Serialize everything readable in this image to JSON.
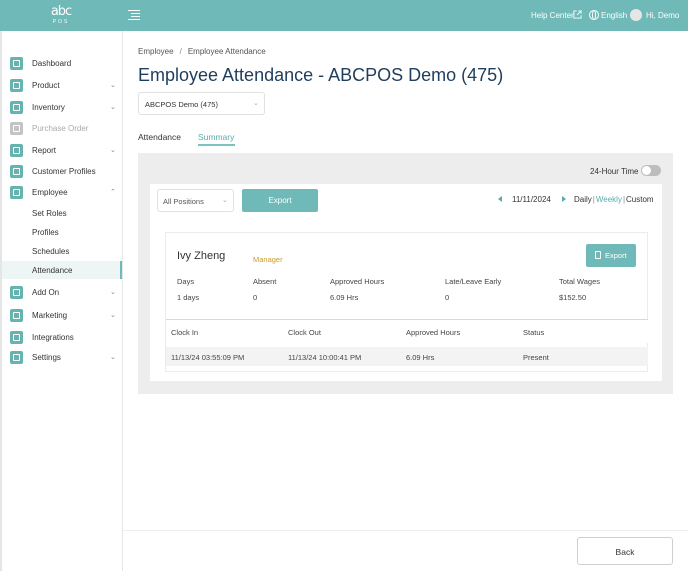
{
  "header": {
    "logo_text": "abc",
    "logo_subtext": "POS",
    "help_center": "Help Center",
    "language": "English",
    "greeting": "Hi, Demo"
  },
  "sidebar": {
    "items": [
      {
        "label": "Dashboard",
        "icon": "home-icon",
        "expandable": false,
        "disabled": false
      },
      {
        "label": "Product",
        "icon": "grid-icon",
        "expandable": true,
        "disabled": false
      },
      {
        "label": "Inventory",
        "icon": "clipboard-icon",
        "expandable": true,
        "disabled": false
      },
      {
        "label": "Purchase Order",
        "icon": "cart-icon",
        "expandable": false,
        "disabled": true
      },
      {
        "label": "Report",
        "icon": "bar-chart-icon",
        "expandable": true,
        "disabled": false
      },
      {
        "label": "Customer Profiles",
        "icon": "user-icon",
        "expandable": false,
        "disabled": false
      },
      {
        "label": "Employee",
        "icon": "id-card-icon",
        "expandable": true,
        "expanded": true,
        "disabled": false
      }
    ],
    "employee_subitems": [
      {
        "label": "Set Roles",
        "active": false
      },
      {
        "label": "Profiles",
        "active": false
      },
      {
        "label": "Schedules",
        "active": false
      },
      {
        "label": "Attendance",
        "active": true
      }
    ],
    "bottom_items": [
      {
        "label": "Add On",
        "icon": "puzzle-icon",
        "expandable": true
      },
      {
        "label": "Marketing",
        "icon": "megaphone-icon",
        "expandable": true
      },
      {
        "label": "Integrations",
        "icon": "share-icon",
        "expandable": false
      },
      {
        "label": "Settings",
        "icon": "gear-icon",
        "expandable": true
      }
    ]
  },
  "breadcrumb": {
    "parent": "Employee",
    "separator": "/",
    "current": "Employee Attendance"
  },
  "page_title": "Employee Attendance - ABCPOS Demo (475)",
  "store_select": {
    "value": "ABCPOS Demo (475)"
  },
  "tabs": [
    {
      "label": "Attendance",
      "active": false
    },
    {
      "label": "Summary",
      "active": true
    }
  ],
  "panel": {
    "time_toggle_label": "24-Hour Time",
    "time_toggle_on": false,
    "positions_select": "All Positions",
    "export_label": "Export",
    "date": "11/11/2024",
    "range": {
      "daily": "Daily",
      "weekly": "Weekly",
      "custom": "Custom",
      "separator": "|",
      "active": "Weekly"
    }
  },
  "employee": {
    "name": "Ivy Zheng",
    "role": "Manager",
    "export_label": "Export",
    "stats": {
      "headers": [
        "Days",
        "Absent",
        "Approved Hours",
        "Late/Leave Early",
        "Total Wages"
      ],
      "values": [
        "1 days",
        "0",
        "6.09 Hrs",
        "0",
        "$152.50"
      ]
    },
    "table": {
      "columns": [
        "Clock In",
        "Clock Out",
        "Approved Hours",
        "Status"
      ],
      "rows": [
        [
          "11/13/24 03:55:09 PM",
          "11/13/24 10:00:41 PM",
          "6.09 Hrs",
          "Present"
        ]
      ]
    }
  },
  "footer": {
    "back_label": "Back"
  },
  "colors": {
    "accent": "#6fb9b8",
    "accent_text": "#56aeab",
    "title": "#1f3d5c",
    "role": "#c99a2e",
    "sidebar_icon": "#66b3b0"
  }
}
